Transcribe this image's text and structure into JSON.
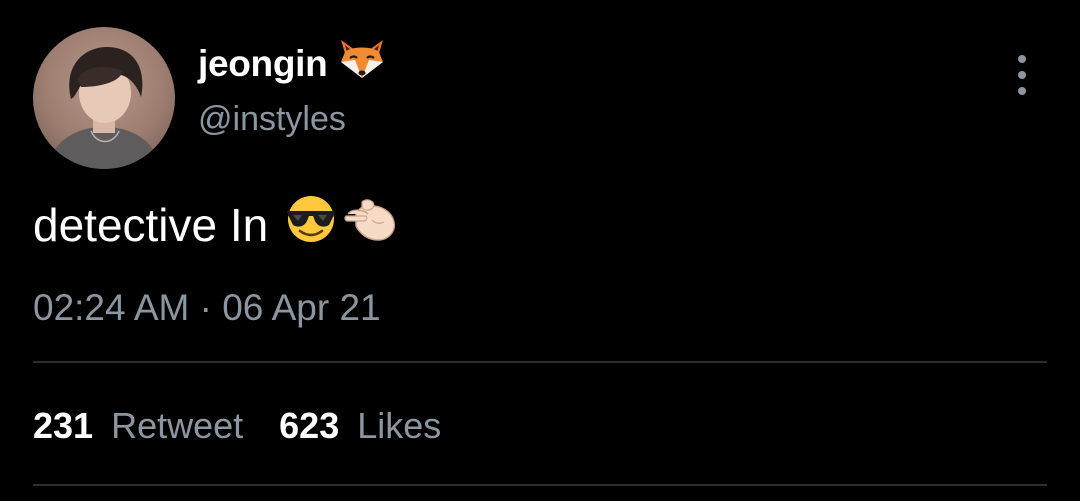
{
  "tweet": {
    "author": {
      "display_name": "jeongin",
      "name_emoji": "fox-face-icon",
      "handle": "@instyles"
    },
    "text": "detective In",
    "text_emojis": [
      "smiling-face-with-sunglasses-icon",
      "pinching-hand-icon"
    ],
    "timestamp": "02:24 AM · 06 Apr 21",
    "stats": {
      "retweets": {
        "count": "231",
        "label": "Retweet"
      },
      "likes": {
        "count": "623",
        "label": "Likes"
      }
    }
  },
  "colors": {
    "background": "#000000",
    "primary_text": "#ffffff",
    "secondary_text": "#8b96a1",
    "divider": "#2a2f33"
  }
}
